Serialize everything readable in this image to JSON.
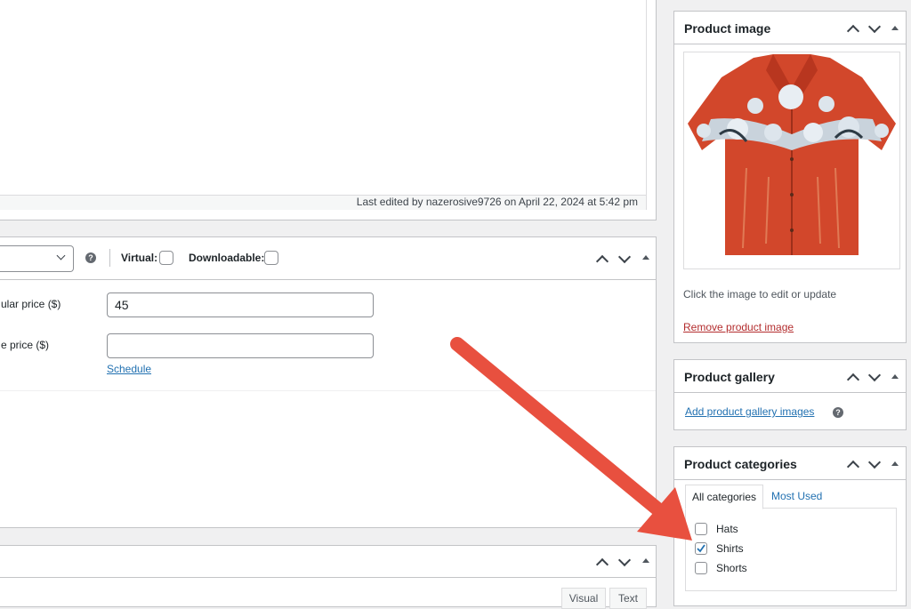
{
  "editor": {
    "last_edited": "Last edited by nazerosive9726 on April 22, 2024 at 5:42 pm"
  },
  "product_data": {
    "virtual_label": "Virtual:",
    "downloadable_label": "Downloadable:",
    "help_symbol": "?",
    "regular_price_label": "ular price ($)",
    "regular_price_value": "45",
    "sale_price_label": "e price ($)",
    "sale_price_value": "",
    "schedule_link": "Schedule"
  },
  "bottom_panel": {
    "visual_tab": "Visual",
    "text_tab": "Text"
  },
  "product_image": {
    "title": "Product image",
    "hint": "Click the image to edit or update",
    "remove_link": "Remove product image"
  },
  "product_gallery": {
    "title": "Product gallery",
    "add_link": "Add product gallery images",
    "help_symbol": "?"
  },
  "product_categories": {
    "title": "Product categories",
    "tab_all": "All categories",
    "tab_most_used": "Most Used",
    "items": [
      {
        "label": "Hats",
        "checked": false
      },
      {
        "label": "Shirts",
        "checked": true
      },
      {
        "label": "Shorts",
        "checked": false
      }
    ]
  },
  "colors": {
    "arrow": "#e8503f",
    "link": "#2271b1",
    "danger": "#b32d2e"
  },
  "icons": [
    "chevron-up-icon",
    "chevron-down-icon",
    "toggle-triangle-icon",
    "help-icon",
    "dropdown-chevron-icon",
    "checkmark-icon",
    "annotation-arrow"
  ]
}
